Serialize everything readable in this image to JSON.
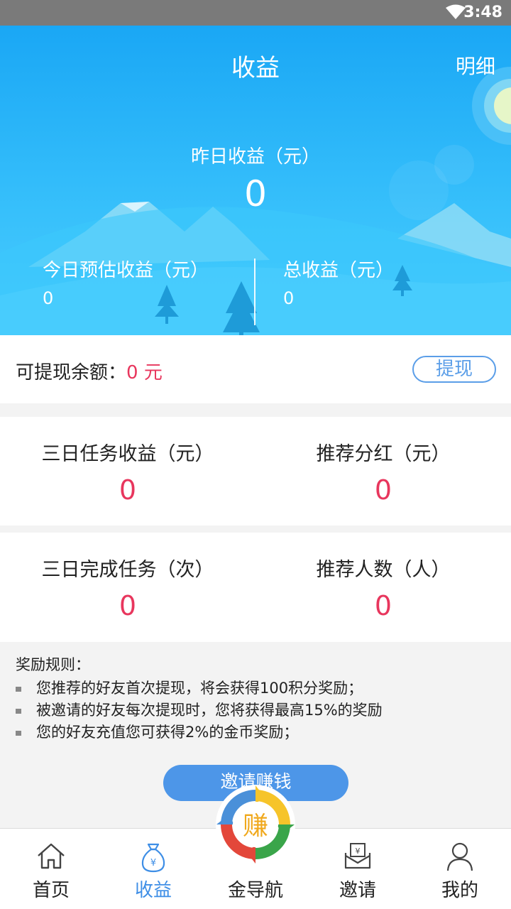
{
  "status_bar": {
    "time": "3:48"
  },
  "header": {
    "title": "收益",
    "detail_link": "明细"
  },
  "hero": {
    "yesterday_label": "昨日收益（元）",
    "yesterday_value": "0",
    "today_label": "今日预估收益（元）",
    "today_value": "0",
    "total_label": "总收益（元）",
    "total_value": "0"
  },
  "balance": {
    "label": "可提现余额：",
    "amount": "0 元",
    "withdraw_label": "提现"
  },
  "stats": {
    "three_day_task_income": {
      "label": "三日任务收益（元）",
      "value": "0"
    },
    "referral_dividend": {
      "label": "推荐分红（元）",
      "value": "0"
    },
    "three_day_tasks_completed": {
      "label": "三日完成任务（次）",
      "value": "0"
    },
    "referral_count": {
      "label": "推荐人数（人）",
      "value": "0"
    }
  },
  "rules": {
    "title": "奖励规则：",
    "items": [
      "您推荐的好友首次提现，将会获得100积分奖励；",
      "被邀请的好友每次提现时，您将获得最高15%的奖励",
      "您的好友充值您可获得2%的金币奖励；"
    ]
  },
  "invite_button": "邀请赚钱",
  "logo_char": "赚",
  "tabs": [
    {
      "label": "首页",
      "icon": "home-icon"
    },
    {
      "label": "收益",
      "icon": "money-bag-icon",
      "active": true
    },
    {
      "label": "金导航",
      "icon": "earn-logo-icon"
    },
    {
      "label": "邀请",
      "icon": "invite-envelope-icon"
    },
    {
      "label": "我的",
      "icon": "user-icon"
    }
  ],
  "colors": {
    "accent": "#3e8ee6",
    "value_red": "#e8365d",
    "hero_blue": "#1aa7f5"
  }
}
